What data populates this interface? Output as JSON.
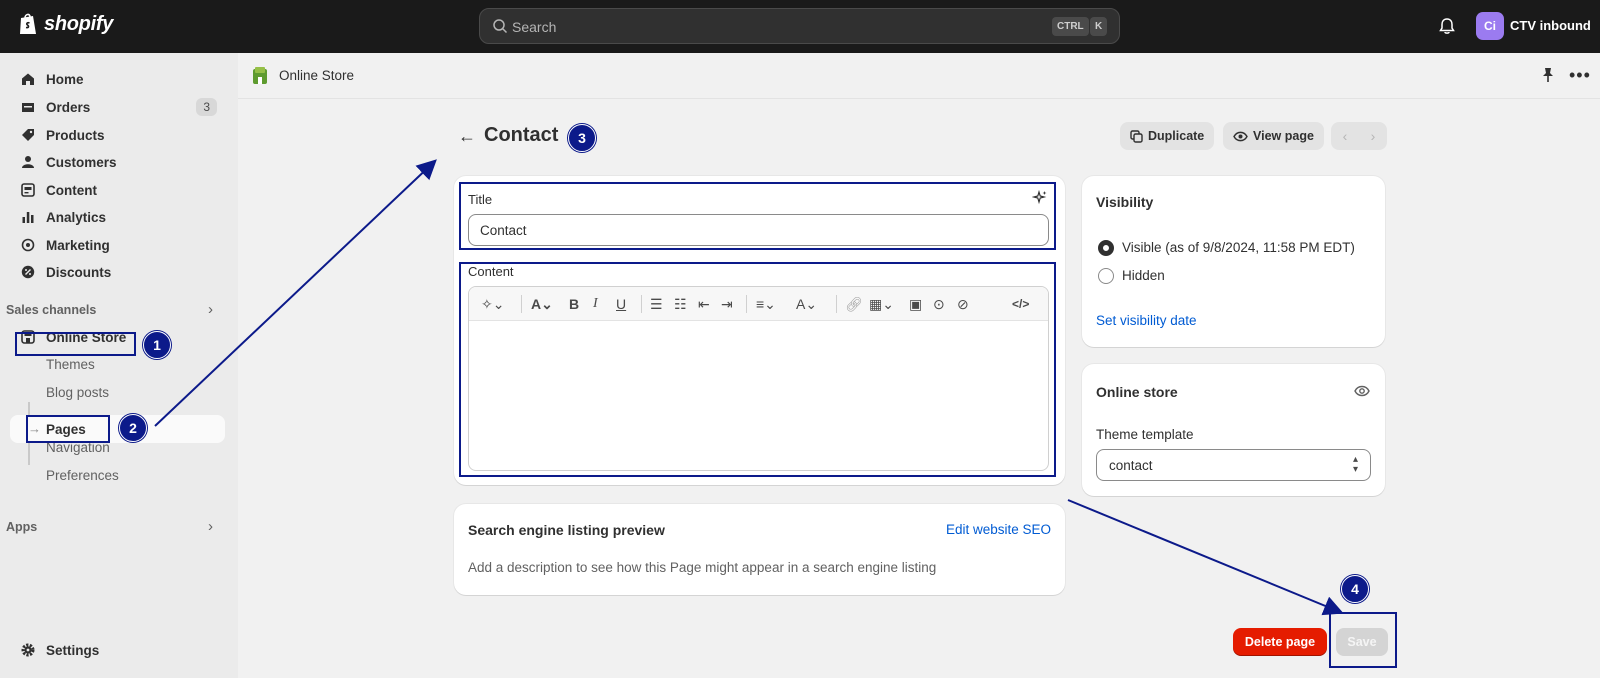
{
  "topbar": {
    "logo_text": "shopify",
    "search_placeholder": "Search",
    "shortcut_ctrl": "CTRL",
    "shortcut_k": "K",
    "avatar_initials": "Ci",
    "store_name": "CTV inbound"
  },
  "sidebar": {
    "items": [
      {
        "label": "Home",
        "icon": "home-icon"
      },
      {
        "label": "Orders",
        "icon": "orders-icon",
        "badge": "3"
      },
      {
        "label": "Products",
        "icon": "tag-icon"
      },
      {
        "label": "Customers",
        "icon": "person-icon"
      },
      {
        "label": "Content",
        "icon": "content-icon"
      },
      {
        "label": "Analytics",
        "icon": "bar-chart-icon"
      },
      {
        "label": "Marketing",
        "icon": "target-icon"
      },
      {
        "label": "Discounts",
        "icon": "discount-icon"
      }
    ],
    "sales_channels_label": "Sales channels",
    "online_store_label": "Online Store",
    "sub_items": [
      "Themes",
      "Blog posts",
      "Pages",
      "Navigation",
      "Preferences"
    ],
    "apps_label": "Apps",
    "settings_label": "Settings"
  },
  "appbar": {
    "title": "Online Store"
  },
  "header": {
    "title": "Contact",
    "duplicate_label": "Duplicate",
    "view_page_label": "View page"
  },
  "editor": {
    "title_label": "Title",
    "title_value": "Contact",
    "content_label": "Content"
  },
  "seo": {
    "title": "Search engine listing preview",
    "edit_link": "Edit website SEO",
    "description": "Add a description to see how this Page might appear in a search engine listing"
  },
  "visibility": {
    "title": "Visibility",
    "visible_label": "Visible (as of 9/8/2024, 11:58 PM EDT)",
    "hidden_label": "Hidden",
    "set_date_link": "Set visibility date",
    "selected": "visible"
  },
  "online_store_card": {
    "title": "Online store",
    "template_label": "Theme template",
    "template_value": "contact"
  },
  "actions": {
    "delete_label": "Delete page",
    "save_label": "Save"
  },
  "annotations": [
    "1",
    "2",
    "3",
    "4"
  ],
  "colors": {
    "annotation": "#0c1a8a",
    "danger": "#e51c00",
    "link": "#005bd3",
    "topbar": "#1a1a1a"
  }
}
